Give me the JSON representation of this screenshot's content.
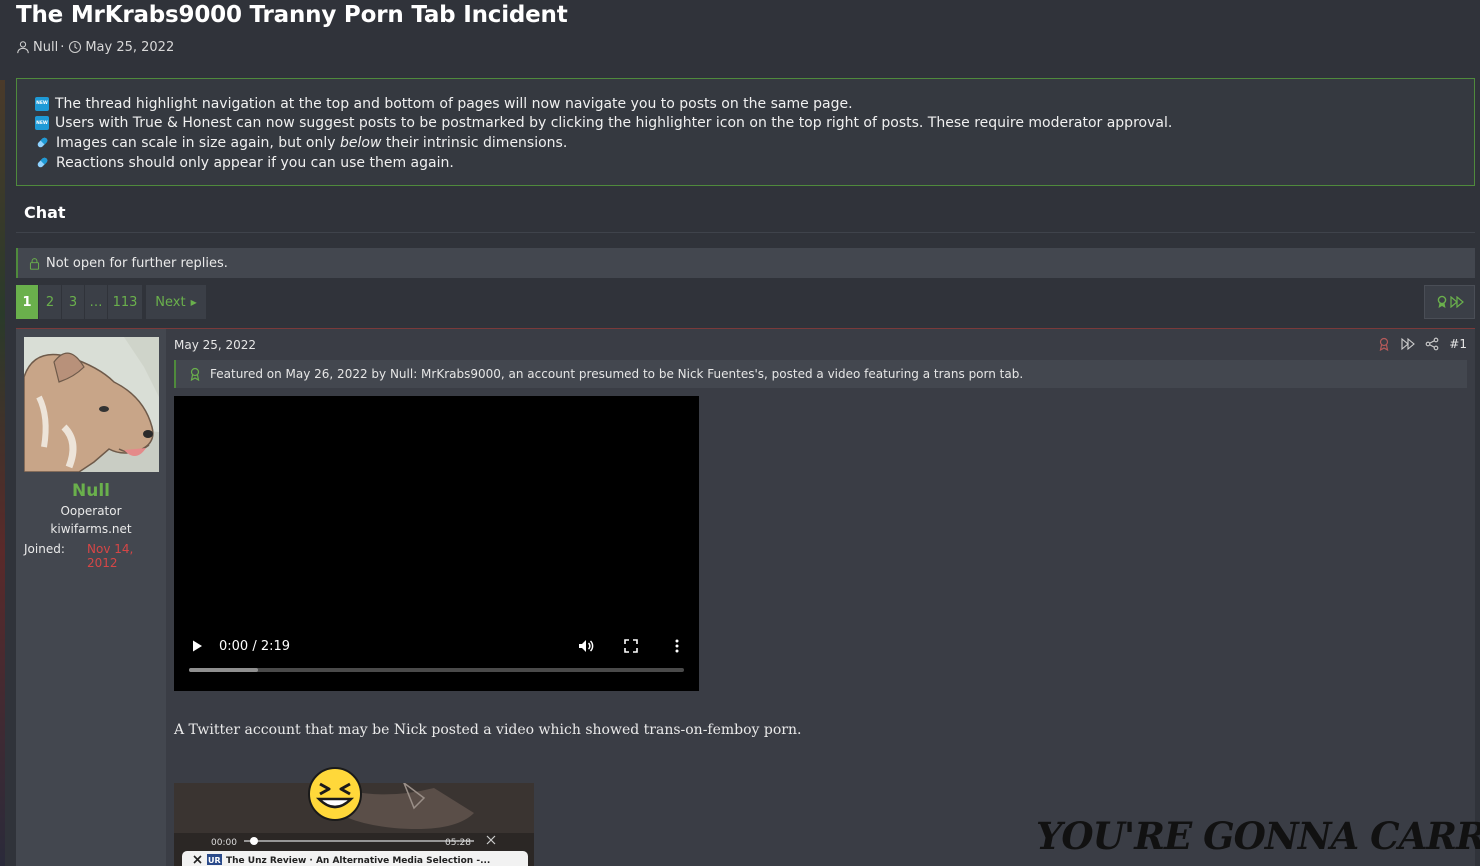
{
  "thread": {
    "title": "The MrKrabs9000 Tranny Porn Tab Incident",
    "author": "Null",
    "separator": "·",
    "date": "May 25, 2022"
  },
  "notices": [
    {
      "icon": "new-badge-icon",
      "badge": "NEW",
      "text": "The thread highlight navigation at the top and bottom of pages will now navigate you to posts on the same page."
    },
    {
      "icon": "new-badge-icon",
      "badge": "NEW",
      "text": "Users with True & Honest can now suggest posts to be postmarked by clicking the highlighter icon on the top right of posts. These require moderator approval."
    },
    {
      "icon": "pill-icon",
      "text_before": "Images can scale in size again, but only ",
      "text_em": "below",
      "text_after": " their intrinsic dimensions."
    },
    {
      "icon": "pill-icon",
      "text": "Reactions should only appear if you can use them again."
    }
  ],
  "forum": {
    "section": "Chat",
    "locked_text": "Not open for further replies."
  },
  "pagination": {
    "current": "1",
    "pages": [
      "2",
      "3"
    ],
    "ellipsis": "…",
    "last": "113",
    "next_label": "Next"
  },
  "post": {
    "date": "May 25, 2022",
    "number": "#1",
    "featured_text": "Featured on May 26, 2022 by Null: MrKrabs9000, an account presumed to be Nick Fuentes's, posted a video featuring a trans porn tab.",
    "user": {
      "name": "Null",
      "title": "Ooperator",
      "site": "kiwifarms.net",
      "joined_label": "Joined:",
      "joined_date": "Nov 14, 2012"
    },
    "video": {
      "time": "0:00 / 2:19",
      "buffered_fraction": 0.14
    },
    "body_text": "A Twitter account that may be Nick posted a video which showed trans-on-femboy porn.",
    "embed": {
      "time_start": "00:00",
      "time_end": "05:28",
      "tab_icon": "UR",
      "tab_title": "The Unz Review · An Alternative Media Selection -..."
    }
  },
  "overlay_text": "YOU'RE GONNA CARRY THA",
  "colors": {
    "background": "#30333a",
    "accent_green": "#6ab04c",
    "date_red": "#d64646",
    "new_badge": "#1e9ad6"
  }
}
